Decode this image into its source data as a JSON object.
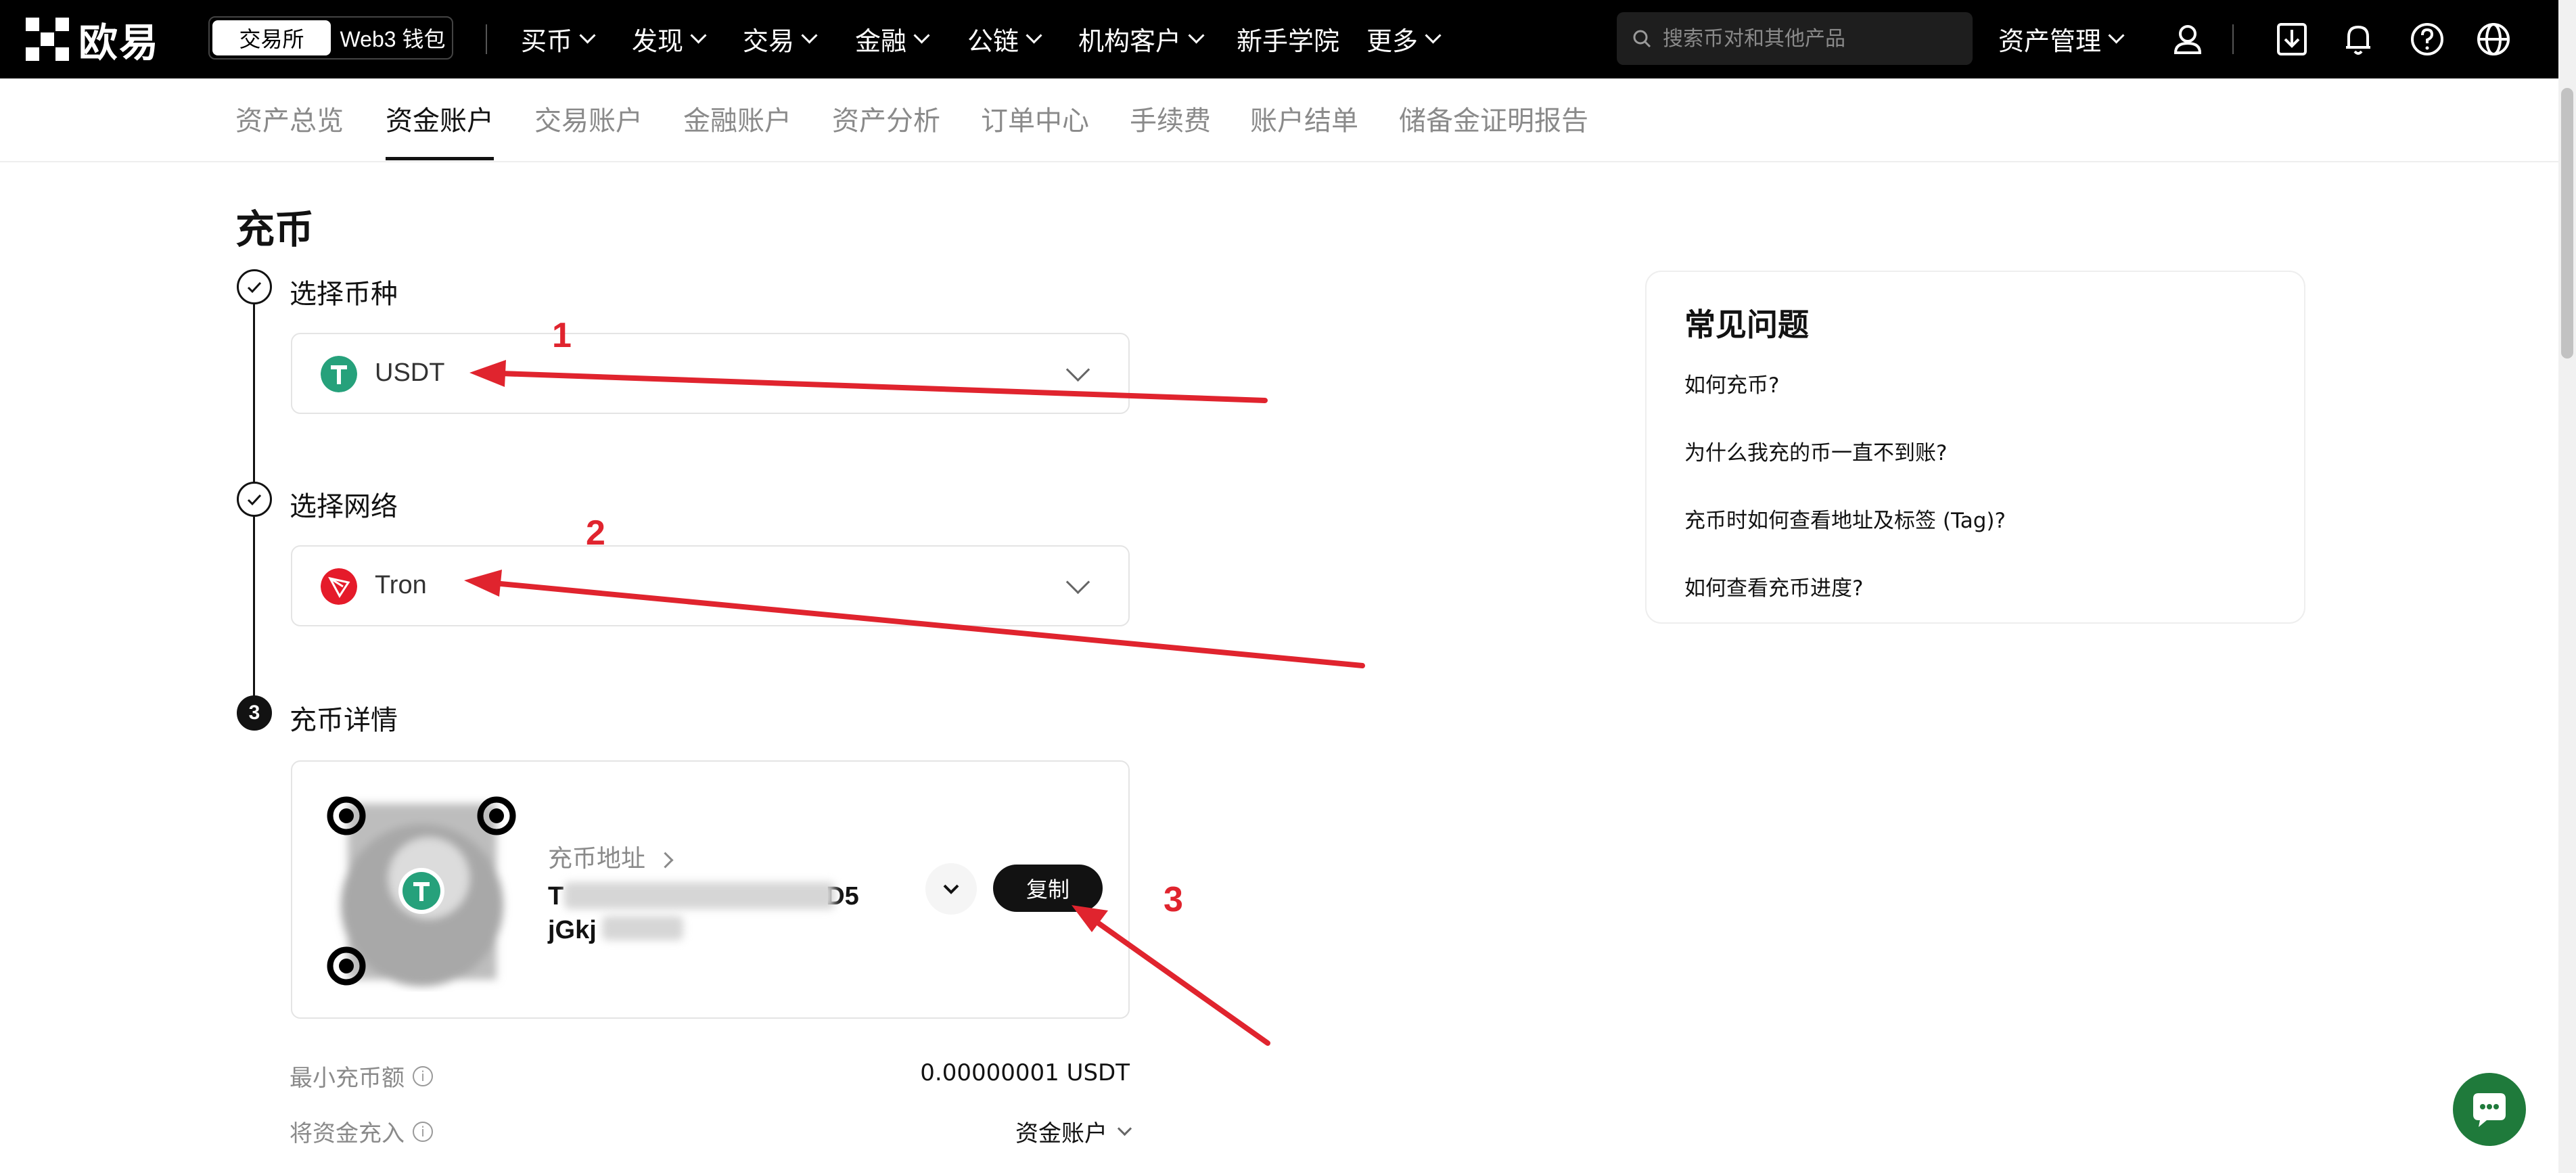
{
  "topnav": {
    "brand": "欧易",
    "segment": [
      "交易所",
      "Web3 钱包"
    ],
    "items": [
      "买币",
      "发现",
      "交易",
      "金融",
      "公链",
      "机构客户",
      "新手学院",
      "更多"
    ],
    "search_placeholder": "搜索币对和其他产品",
    "asset_mgmt": "资产管理"
  },
  "subnav": [
    "资产总览",
    "资金账户",
    "交易账户",
    "金融账户",
    "资产分析",
    "订单中心",
    "手续费",
    "账户结单",
    "储备金证明报告"
  ],
  "page": {
    "title": "充币",
    "step1": {
      "label": "选择币种",
      "value": "USDT"
    },
    "step2": {
      "label": "选择网络",
      "value": "Tron"
    },
    "step3": {
      "number": "3",
      "label": "充币详情",
      "address_label": "充币地址",
      "address_line1_start": "T",
      "address_line1_end": "D5",
      "address_line2_start": "jGkj",
      "copy": "复制"
    },
    "min_deposit_label": "最小充币额",
    "min_deposit_value": "0.00000001 USDT",
    "deposit_to_label": "将资金充入",
    "deposit_to_value": "资金账户"
  },
  "faq": {
    "title": "常见问题",
    "items": [
      "如何充币?",
      "为什么我充的币一直不到账?",
      "充币时如何查看地址及标签 (Tag)?",
      "如何查看充币进度?"
    ]
  },
  "annotations": [
    "1",
    "2",
    "3"
  ],
  "colors": {
    "accent": "#121212",
    "usdt": "#26a17b",
    "tron": "#e51b2a",
    "annotation": "#e0242e",
    "chat": "#1f7a3b"
  }
}
